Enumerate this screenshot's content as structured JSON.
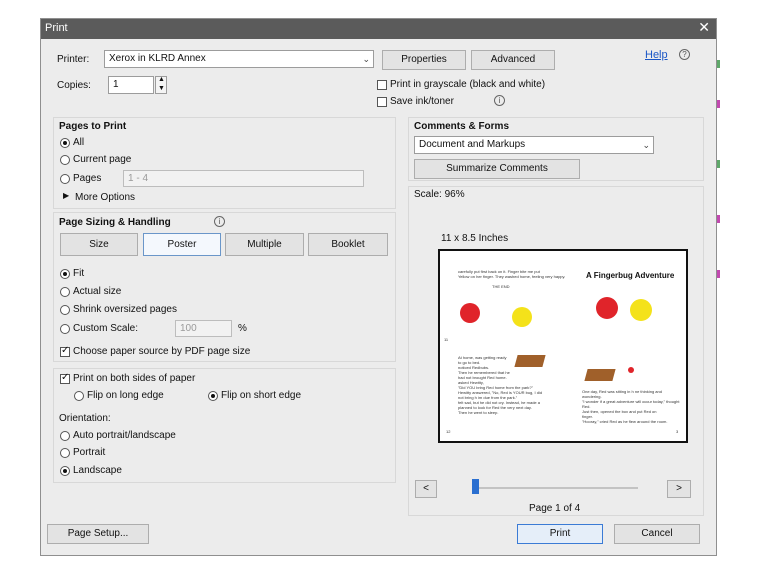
{
  "dialog": {
    "title": "Print",
    "close_glyph": "✕",
    "help_label": "Help",
    "help_icon_glyph": "?"
  },
  "printer": {
    "label": "Printer:",
    "selected": "Xerox in KLRD Annex",
    "properties_label": "Properties",
    "advanced_label": "Advanced"
  },
  "copies": {
    "label": "Copies:",
    "value": "1"
  },
  "options": {
    "grayscale_label": "Print in grayscale (black and white)",
    "grayscale_checked": false,
    "save_ink_label": "Save ink/toner",
    "save_ink_checked": false,
    "info_glyph": "i"
  },
  "pages_to_print": {
    "title": "Pages to Print",
    "all_label": "All",
    "current_label": "Current page",
    "pages_label": "Pages",
    "pages_placeholder": "1 - 4",
    "more_options_label": "More Options",
    "selected": "All"
  },
  "page_sizing": {
    "title": "Page Sizing & Handling",
    "tabs": [
      {
        "label": "Size"
      },
      {
        "label": "Poster"
      },
      {
        "label": "Multiple"
      },
      {
        "label": "Booklet"
      }
    ],
    "fit_label": "Fit",
    "actual_label": "Actual size",
    "shrink_label": "Shrink oversized pages",
    "custom_label": "Custom Scale:",
    "custom_value": "100",
    "custom_unit": "%",
    "selected": "Fit",
    "paper_source_label": "Choose paper source by PDF page size",
    "paper_source_checked": true
  },
  "duplex": {
    "both_sides_label": "Print on both sides of paper",
    "both_sides_checked": true,
    "long_edge_label": "Flip on long edge",
    "short_edge_label": "Flip on short edge",
    "selected": "Flip on short edge"
  },
  "orientation": {
    "title": "Orientation:",
    "auto_label": "Auto portrait/landscape",
    "portrait_label": "Portrait",
    "landscape_label": "Landscape",
    "selected": "Landscape"
  },
  "comments_forms": {
    "title": "Comments & Forms",
    "selected": "Document and Markups",
    "summarize_label": "Summarize Comments"
  },
  "preview": {
    "scale_label": "Scale:  96%",
    "paper_size_label": "11 x 8.5 Inches",
    "page_indicator": "Page 1 of 4",
    "prev_glyph": "<",
    "next_glyph": ">",
    "page_title": "A  Fingerbug  Adventure",
    "page_number_left": "12",
    "page_number_right": "3",
    "page_number_mid": "11",
    "text_lines_left_top": [
      "carefully put first back on it.    Finger  bite me put",
      "Yellow on her finger. They washed home, feeling very happy.",
      "THE END"
    ],
    "text_lines_left_bottom": [
      "At home,           was getting ready",
      "to go to bed.",
      "         noticed Redbubs.",
      "Then  he remembered that    he",
      "had not brought Red home.",
      "              asked Hewitty,",
      "\"Did YOU bring Red home from the park?\"",
      "Hewitty answered, \"No,            Red is YOUR bug, I did",
      "not bring h    im due from the park.\"",
      "          felt sad, but     he did not cry. Instead,    he made a",
      "                planned to look for Red the very next day.",
      "Then    he went to sleep."
    ],
    "text_lines_right_bottom": [
      "One day, Red was sitting in h         ne thinking and",
      "wondering.",
      "\"I wonder if a great adventure will occur today,\" thought",
      "Red.",
      "Just then,                 opened the box and put Red on",
      "finger.",
      "\"Hooray,\" cried Red as     he flew around the room."
    ]
  },
  "footer": {
    "page_setup_label": "Page Setup...",
    "print_label": "Print",
    "cancel_label": "Cancel"
  },
  "colors": {
    "titlebar": "#5b5b5b",
    "dialog_bg": "#ececec",
    "link": "#1a56c6",
    "primary_border": "#3b7bd5",
    "bug_red": "#e0242a",
    "bug_yellow": "#f4e21a",
    "box_brown": "#a0602a",
    "slider_thumb": "#2a6fd0"
  }
}
